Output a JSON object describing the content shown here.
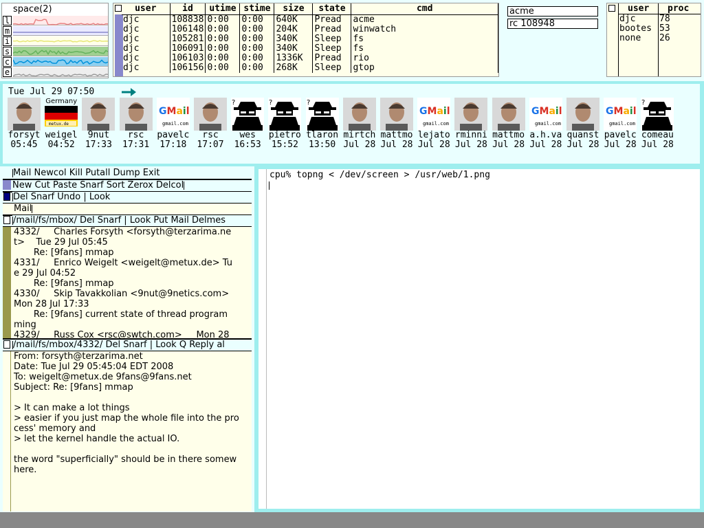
{
  "stats": {
    "title": "space(2)",
    "labels": [
      "l",
      "m",
      "i",
      "s",
      "c",
      "e"
    ]
  },
  "ps": {
    "headers": [
      "user",
      "id",
      "utime",
      "stime",
      "size",
      "state",
      "cmd"
    ],
    "rows": [
      [
        "djc",
        "108838",
        "0:00",
        "0:00",
        "640K",
        "Pread",
        "acme"
      ],
      [
        "djc",
        "106148",
        "0:00",
        "0:00",
        "204K",
        "Pread",
        "winwatch"
      ],
      [
        "djc",
        "105281",
        "0:00",
        "0:00",
        "340K",
        "Sleep",
        "fs"
      ],
      [
        "djc",
        "106091",
        "0:00",
        "0:00",
        "340K",
        "Sleep",
        "fs"
      ],
      [
        "djc",
        "106103",
        "0:00",
        "0:00",
        "1336K",
        "Pread",
        "rio"
      ],
      [
        "djc",
        "106156",
        "0:00",
        "0:00",
        "268K",
        "Sleep",
        "gtop"
      ]
    ]
  },
  "winwatch": {
    "items": [
      "acme",
      "rc 108948"
    ]
  },
  "userproc": {
    "headers": [
      "user",
      "proc"
    ],
    "rows": [
      [
        "djc",
        "78"
      ],
      [
        "bootes",
        "53"
      ],
      [
        "none",
        "26"
      ]
    ]
  },
  "faces": {
    "date": "Tue Jul 29 07:50",
    "germany_label": "Germany",
    "items": [
      {
        "name": "forsyt",
        "time": "05:45",
        "kind": "photo"
      },
      {
        "name": "weigel",
        "time": "04:52",
        "kind": "flag"
      },
      {
        "name": "9nut",
        "time": "17:33",
        "kind": "photo"
      },
      {
        "name": "rsc",
        "time": "17:31",
        "kind": "photo"
      },
      {
        "name": "pavelc",
        "time": "17:18",
        "kind": "gmail"
      },
      {
        "name": "rsc",
        "time": "17:07",
        "kind": "photo"
      },
      {
        "name": "wes",
        "time": "16:53",
        "kind": "spy"
      },
      {
        "name": "pietro",
        "time": "15:52",
        "kind": "spy"
      },
      {
        "name": "tlaron",
        "time": "13:50",
        "kind": "spy"
      },
      {
        "name": "mirtch",
        "time": "Jul 28",
        "kind": "photo"
      },
      {
        "name": "mattmo",
        "time": "Jul 28",
        "kind": "photo"
      },
      {
        "name": "lejato",
        "time": "Jul 28",
        "kind": "gmail"
      },
      {
        "name": "rminni",
        "time": "Jul 28",
        "kind": "photo"
      },
      {
        "name": "mattmo",
        "time": "Jul 28",
        "kind": "photo"
      },
      {
        "name": "a.h.va",
        "time": "Jul 28",
        "kind": "gmail"
      },
      {
        "name": "quanst",
        "time": "Jul 28",
        "kind": "photo"
      },
      {
        "name": "pavelc",
        "time": "Jul 28",
        "kind": "gmail"
      },
      {
        "name": "comeau",
        "time": "Jul 28",
        "kind": "spy"
      }
    ]
  },
  "acme": {
    "tag_main": "Mail Newcol Kill Putall Dump Exit",
    "tag_col": "New Cut Paste Snarf Sort Zerox Delcol",
    "tag_win1": "Del Snarf Undo | Look",
    "win1_body": "Mail",
    "tag_mbox": "/mail/fs/mbox/ Del Snarf | Look Put Mail Delmes",
    "mbox_lines": [
      "4332/     Charles Forsyth <forsyth@terzarima.ne",
      "t>    Tue 29 Jul 05:45",
      "       Re: [9fans] mmap",
      "4331/     Enrico Weigelt <weigelt@metux.de> Tu",
      "e 29 Jul 04:52",
      "       Re: [9fans] mmap",
      "4330/     Skip Tavakkolian <9nut@9netics.com>",
      "Mon 28 Jul 17:33",
      "       Re: [9fans] current state of thread program",
      "ming",
      "4329/     Russ Cox <rsc@swtch.com>     Mon 28"
    ],
    "tag_msg": "/mail/fs/mbox/4332/ Del Snarf | Look Q Reply al",
    "msg_lines": [
      "From: forsyth@terzarima.net",
      "Date: Tue Jul 29 05:45:04 EDT 2008",
      "To: weigelt@metux.de 9fans@9fans.net",
      "Subject: Re: [9fans] mmap",
      "",
      "> It can make a lot things",
      "> easier if you just map the whole file into the pro",
      "cess' memory and",
      "> let the kernel handle the actual IO.",
      "",
      "the word \"superficially\" should be in there somew",
      "here."
    ]
  },
  "rio": {
    "command": "cpu% topng < /dev/screen > /usr/web/1.png"
  },
  "colors": {
    "pale_cyan": "#eaffff",
    "pale_yellow": "#ffffea",
    "border_cyan": "#9eeeee",
    "scroll_olive": "#99994c",
    "desktop_gray": "#888888",
    "acme_blue": "#8888cc",
    "arrow_teal": "#008080"
  }
}
